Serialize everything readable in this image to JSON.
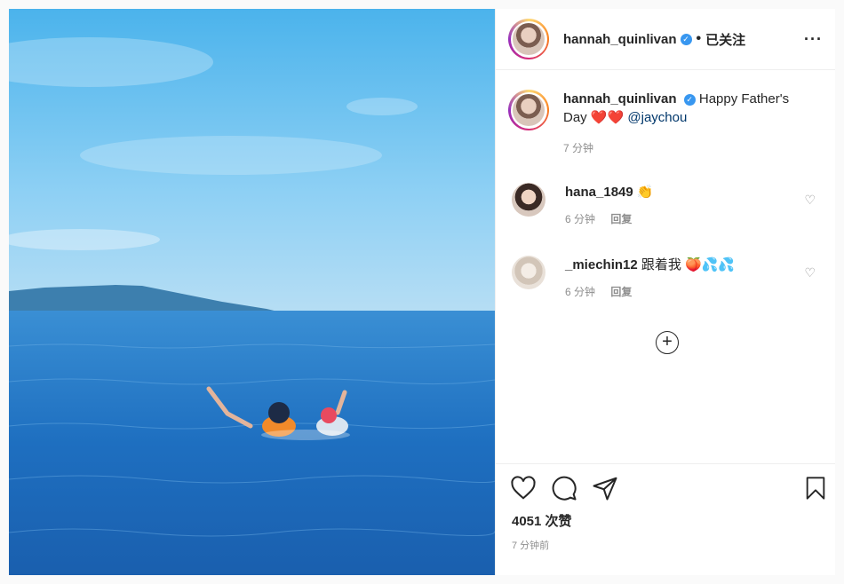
{
  "post": {
    "username": "hannah_quinlivan",
    "separator": "•",
    "follow_status": "已关注",
    "more": "···"
  },
  "caption": {
    "username": "hannah_quinlivan",
    "text": "Happy Father's Day",
    "hearts": "❤️❤️",
    "mention": "@jaychou",
    "time": "7 分钟"
  },
  "comments": [
    {
      "username": "hana_1849",
      "text": "👏",
      "time": "6 分钟",
      "reply": "回复"
    },
    {
      "username": "_miechin12",
      "text": "跟着我 🍑💦💦",
      "time": "6 分钟",
      "reply": "回复"
    }
  ],
  "footer": {
    "likes": "4051 次赞",
    "posted": "7 分钟前"
  },
  "colors": {
    "accent": "#3897f0",
    "heart": "#e0245e",
    "mention": "#00376b",
    "muted": "#8e8e8e"
  },
  "icons": [
    "verified-badge-icon",
    "heart-icon",
    "comment-icon",
    "share-icon",
    "bookmark-icon",
    "add-comments-icon"
  ]
}
